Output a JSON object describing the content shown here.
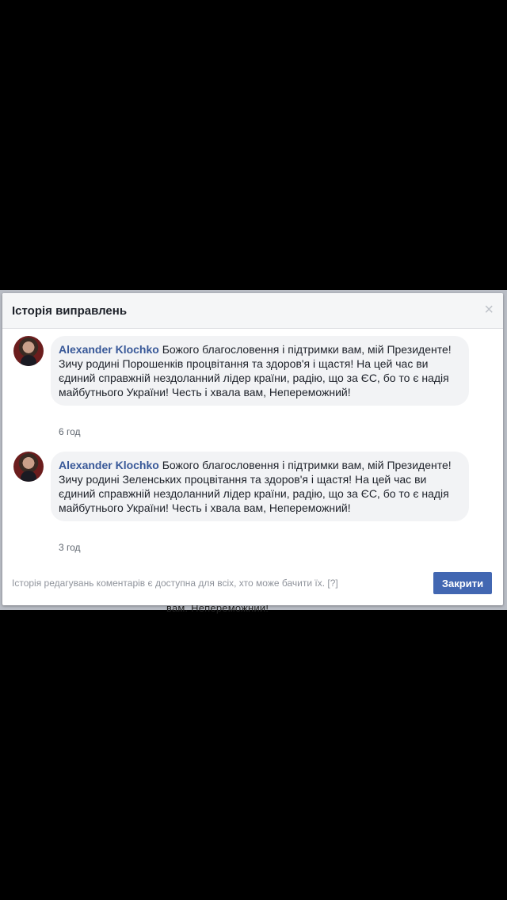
{
  "background": {
    "partial_text": "вам. Непереможний!"
  },
  "dialog": {
    "title": "Історія виправлень",
    "close_symbol": "×"
  },
  "comments": [
    {
      "author": "Alexander Klochko",
      "text": "Божого благословення і підтримки вам, мій Президенте! Зичу родині Порошенків процвітання та здоров'я і щастя! На цей час ви єдиний справжній нездоланний лідер країни, радію, що за ЄС, бо то є надія майбутнього України! Честь і хвала вам, Непереможний!",
      "time": "6 год"
    },
    {
      "author": "Alexander Klochko",
      "text": "Божого благословення і підтримки вам, мій Президенте! Зичу родині Зеленських процвітання та здоров'я і щастя! На цей час ви єдиний справжній нездоланний лідер країни, радію, що за ЄС, бо то є надія майбутнього України! Честь і хвала вам, Непереможний!",
      "time": "3 год"
    }
  ],
  "footer": {
    "info_text": "Історія редагувань коментарів є доступна для всіх, хто може бачити їх.",
    "help_link": "[?]",
    "close_button": "Закрити"
  },
  "colors": {
    "author_link": "#385898",
    "button": "#4267b2",
    "bubble": "#f2f3f5"
  },
  "icons": {
    "close": "close-icon",
    "avatar": "avatar"
  }
}
